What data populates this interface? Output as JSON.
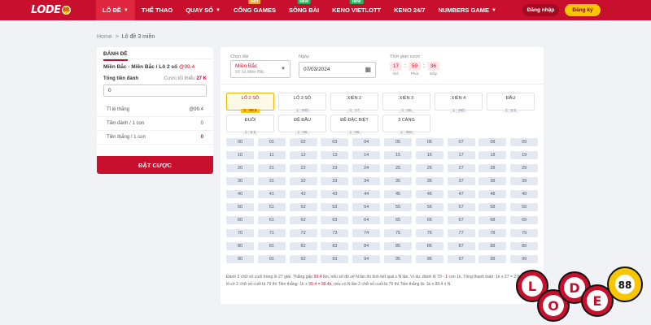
{
  "header": {
    "logo_text": "LODE",
    "logo_ball": "88",
    "nav": [
      {
        "label": "LÔ ĐỀ",
        "caret": true,
        "badge": null,
        "active": true
      },
      {
        "label": "THỂ THAO",
        "caret": false,
        "badge": null,
        "active": false
      },
      {
        "label": "QUAY SỐ",
        "caret": true,
        "badge": null,
        "active": false
      },
      {
        "label": "CỔNG GAMES",
        "caret": false,
        "badge": "HOT",
        "active": false
      },
      {
        "label": "SÒNG BÀI",
        "caret": false,
        "badge": "NEW",
        "active": false
      },
      {
        "label": "KENO VIETLOTT",
        "caret": false,
        "badge": "NEW",
        "active": false
      },
      {
        "label": "KENO 24/7",
        "caret": false,
        "badge": null,
        "active": false
      },
      {
        "label": "NUMBERS GAME",
        "caret": true,
        "badge": null,
        "active": false
      }
    ],
    "login_label": "Đăng nhập",
    "register_label": "Đăng ký"
  },
  "breadcrumb": {
    "home": "Home",
    "sep": ">",
    "current": "Lô đề 3 miền"
  },
  "bet_panel": {
    "tab_label": "ĐÁNH ĐỀ",
    "bet_title": "Miền Bắc - Miền Bắc / Lô 2 số",
    "bet_odd": "@99.4",
    "total_label": "Tổng tiền đánh",
    "min_label": "Cược tối thiểu",
    "min_value": "27 K",
    "amount_value": "0",
    "rows": [
      {
        "label": "Tỉ lệ thắng",
        "value": "@99.4",
        "red": false
      },
      {
        "label": "Tiền đánh / 1 con",
        "value": "0",
        "red": false
      },
      {
        "label": "Tiền thắng / 1 con",
        "value": "0",
        "red": true
      }
    ],
    "place_bet_label": "ĐẶT CƯỢC"
  },
  "form": {
    "region_label": "Chọn đài",
    "region_value": "Miền Bắc",
    "region_sub": "Xổ Số Miền Bắc",
    "date_label": "Ngày",
    "date_value": "07/03/2024",
    "timer_label": "Thời gian cược",
    "timer": [
      {
        "value": "17",
        "unit": "Giờ"
      },
      {
        "value": "59",
        "unit": "Phút"
      },
      {
        "value": "36",
        "unit": "Giây"
      }
    ]
  },
  "bet_types": [
    {
      "name": "LÔ 2 SỐ",
      "odd": "1 : 99.4",
      "active": true
    },
    {
      "name": "LÔ 3 SỐ",
      "odd": "1 : 900",
      "active": false
    },
    {
      "name": "XIÊN 2",
      "odd": "1 : 17",
      "active": false
    },
    {
      "name": "XIÊN 3",
      "odd": "1 : 65",
      "active": false
    },
    {
      "name": "XIÊN 4",
      "odd": "1 : 250",
      "active": false
    },
    {
      "name": "ĐẦU",
      "odd": "1 : 9.5",
      "active": false
    },
    {
      "name": "ĐUÔI",
      "odd": "1 : 9.5",
      "active": false
    },
    {
      "name": "ĐỀ ĐẦU",
      "odd": "1 : 95",
      "active": false
    },
    {
      "name": "ĐỀ ĐẶC BIỆT",
      "odd": "1 : 95",
      "active": false
    },
    {
      "name": "3 CÀNG",
      "odd": "1 : 900",
      "active": false
    }
  ],
  "numbers": [
    "00",
    "01",
    "02",
    "03",
    "04",
    "05",
    "06",
    "07",
    "08",
    "09",
    "10",
    "11",
    "12",
    "13",
    "14",
    "15",
    "16",
    "17",
    "18",
    "19",
    "20",
    "21",
    "22",
    "23",
    "24",
    "25",
    "26",
    "27",
    "28",
    "29",
    "30",
    "31",
    "32",
    "33",
    "34",
    "35",
    "36",
    "37",
    "38",
    "39",
    "40",
    "41",
    "42",
    "43",
    "44",
    "45",
    "46",
    "47",
    "48",
    "49",
    "50",
    "51",
    "52",
    "53",
    "54",
    "55",
    "56",
    "57",
    "58",
    "59",
    "60",
    "61",
    "62",
    "63",
    "64",
    "65",
    "66",
    "67",
    "68",
    "69",
    "70",
    "71",
    "72",
    "73",
    "74",
    "75",
    "76",
    "77",
    "78",
    "79",
    "80",
    "81",
    "82",
    "83",
    "84",
    "85",
    "86",
    "87",
    "88",
    "89",
    "90",
    "91",
    "92",
    "93",
    "94",
    "95",
    "96",
    "97",
    "98",
    "99"
  ],
  "description": {
    "p1": "Đánh 2 chữ số cuối trong lô 27 giải. Thắng gấp ",
    "hl1": "99.4",
    "p2": " lần, nếu số đó về N lần thì tính kết quả x N lần. Ví dụ: đánh lô 79 - ",
    "hl2": "1",
    "p3": " con 1k, Tổng thanh toán: 1k x 27 = 27k. Nếu trong lô có 2 chữ số cuối là 79 thì Tiền thắng: 1k x ",
    "hl3": "99.4 = 99.4k",
    "p4": ", nếu có N lần 2 chữ số cuối là 79 thì Tiền thắng là: 1k x 99.4 x N"
  },
  "decoration": {
    "letters": [
      "L",
      "O",
      "D",
      "E"
    ],
    "ball": "88"
  },
  "colors": {
    "brand": "#c8102e",
    "accent": "#f7c600",
    "grid": "#e4e9f1"
  }
}
